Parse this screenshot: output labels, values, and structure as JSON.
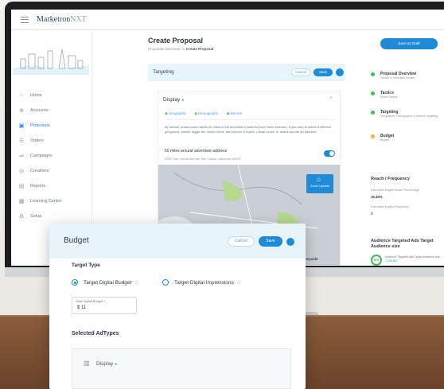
{
  "app": {
    "logo_main": "Marketron",
    "logo_suffix": "NXT"
  },
  "sidebar": {
    "items": [
      {
        "label": "Home",
        "icon": "home-icon",
        "glyph": "⌂"
      },
      {
        "label": "Accounts",
        "icon": "accounts-icon",
        "glyph": "⊕"
      },
      {
        "label": "Proposals",
        "icon": "proposals-icon",
        "glyph": "▣"
      },
      {
        "label": "Orders",
        "icon": "orders-icon",
        "glyph": "☰"
      },
      {
        "label": "Campaigns",
        "icon": "campaigns-icon",
        "glyph": "⇌"
      },
      {
        "label": "Creatives",
        "icon": "creatives-icon",
        "glyph": "◎"
      },
      {
        "label": "Reports",
        "icon": "reports-icon",
        "glyph": "▤"
      },
      {
        "label": "Learning Center",
        "icon": "learning-icon",
        "glyph": "▦"
      },
      {
        "label": "Setup",
        "icon": "setup-icon",
        "glyph": "⚙"
      }
    ]
  },
  "header": {
    "title": "Create Proposal",
    "breadcrumb_parent": "Proposals Overview",
    "breadcrumb_sep": ">>",
    "breadcrumb_current": "Create Proposal"
  },
  "targeting": {
    "label": "Targeting",
    "cancel": "Cancel",
    "save": "Save"
  },
  "display": {
    "title": "Display",
    "tabs": [
      "Geographic",
      "Demographic",
      "Interest"
    ],
    "description": "By default, postal codes within 50 miles of the advertiser's address have been selected. If you wish to select a different geography, please toggle the option below, and choose a region, postal codes, or radius around an address.",
    "radius_label": "50 miles around advertiser address",
    "address": "2000 San Carlos Avenue San Carlos California 94070",
    "map_button": "Zoom Update",
    "map_city": "Sunnyvale"
  },
  "right_panel": {
    "action_button": "Save as Draft",
    "steps": [
      {
        "title": "Proposal Overview",
        "sub": "Header & Advertiser Details",
        "status": "done"
      },
      {
        "title": "Tactics",
        "sub": "Select Tactics",
        "status": "done"
      },
      {
        "title": "Targeting",
        "sub": "Geographic, Demographic & Interest Targeting",
        "status": "done"
      },
      {
        "title": "Budget",
        "sub": "Budget",
        "status": "pending"
      }
    ],
    "reach_title": "Reach / Frequency",
    "reach_label_1": "Estimated Digital Reach Percentage",
    "reach_value_1": "15.45%",
    "reach_label_2": "Estimated Digital Frequency",
    "reach_value_2": "3",
    "audience_title": "Audience Targeted Ads Target Audience size",
    "audience_pct": "29%",
    "audience_text": "Audience Targeted Ads Target Audience size",
    "audience_link": "1,234,567"
  },
  "budget": {
    "title": "Budget",
    "cancel": "Cancel",
    "save": "Save",
    "target_type_label": "Target Type",
    "option_1": "Target Digital Budget",
    "option_2": "Target Digital Impressions",
    "input_label": "Total Digital Budget *",
    "input_value": "$ 11",
    "selected_adtypes_label": "Selected AdTypes",
    "adtype_name": "Display"
  },
  "colors": {
    "accent": "#1f8ad6",
    "success": "#43b95c",
    "warning": "#f2b337",
    "header_tint": "#e7f5fb"
  }
}
